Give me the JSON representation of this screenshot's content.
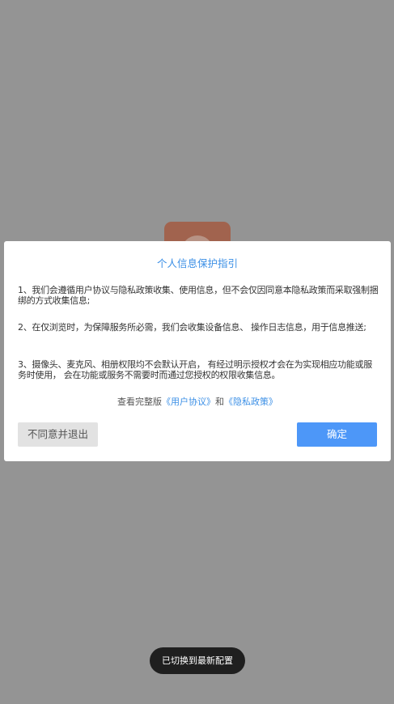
{
  "colors": {
    "overlay": "#949494",
    "accent": "#3b8fe6",
    "confirm": "#4d97f8",
    "decline_bg": "#e2e2e2",
    "toast_bg": "#1f1f1f"
  },
  "background_app": {
    "logo_icon": "app-logo-icon"
  },
  "dialog": {
    "title": "个人信息保护指引",
    "clauses": [
      "1、我们会遵循用户协议与隐私政策收集、使用信息，但不会仅因同意本隐私政策而采取强制捆绑的方式收集信息;",
      "2、在仅浏览时，为保障服务所必需，我们会收集设备信息、 操作日志信息，用于信息推送;",
      "3、摄像头、麦克风、相册权限均不会默认开启， 有经过明示授权才会在为实现相应功能或服务时使用， 会在功能或服务不需要时而通过您授权的权限收集信息。"
    ],
    "links_prefix": "查看完整版",
    "user_agreement_link": "《用户协议》",
    "links_joiner": "和",
    "privacy_policy_link": "《隐私政策》",
    "decline_label": "不同意并退出",
    "confirm_label": "确定"
  },
  "toast": {
    "message": "已切换到最新配置"
  }
}
